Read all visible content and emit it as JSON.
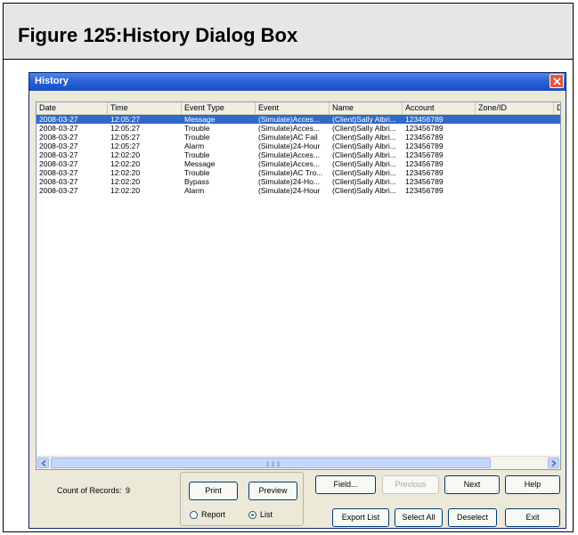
{
  "figure": {
    "title": "Figure 125:History Dialog Box"
  },
  "dialog": {
    "title": "History"
  },
  "columns": [
    "Date",
    "Time",
    "Event Type",
    "Event",
    "Name",
    "Account",
    "Zone/ID",
    "D"
  ],
  "rows": [
    [
      "2008-03-27",
      "12:05:27",
      "Message",
      "(Simulate)Acces...",
      "(Client)Sally Albri...",
      "123456789"
    ],
    [
      "2008-03-27",
      "12:05:27",
      "Trouble",
      "(Simulate)Acces...",
      "(Client)Sally Albri...",
      "123456789"
    ],
    [
      "2008-03-27",
      "12:05:27",
      "Trouble",
      "(Simulate)AC Fail",
      "(Client)Sally Albri...",
      "123456789"
    ],
    [
      "2008-03-27",
      "12:05:27",
      "Alarm",
      "(Simulate)24-Hour",
      "(Client)Sally Albri...",
      "123456789"
    ],
    [
      "2008-03-27",
      "12:02:20",
      "Trouble",
      "(Simulate)Acces...",
      "(Client)Sally Albri...",
      "123456789"
    ],
    [
      "2008-03-27",
      "12:02:20",
      "Message",
      "(Simulate)Acces...",
      "(Client)Sally Albri...",
      "123456789"
    ],
    [
      "2008-03-27",
      "12:02:20",
      "Trouble",
      "(Simulate)AC Tro...",
      "(Client)Sally Albri...",
      "123456789"
    ],
    [
      "2008-03-27",
      "12:02:20",
      "Bypass",
      "(Simulate)24-Ho...",
      "(Client)Sally Albri...",
      "123456789"
    ],
    [
      "2008-03-27",
      "12:02:20",
      "Alarm",
      "(Simulate)24-Hour",
      "(Client)Sally Albri...",
      "123456789"
    ]
  ],
  "selected_row": 0,
  "footer": {
    "count_label": "Count of Records:",
    "count_value": "9",
    "print": "Print",
    "preview": "Preview",
    "report": "Report",
    "list": "List",
    "output_selected": "List",
    "field": "Field...",
    "previous": "Previous",
    "next": "Next",
    "help": "Help",
    "export_list": "Export List",
    "select_all": "Select All",
    "deselect": "Deselect",
    "exit": "Exit"
  },
  "colors": {
    "selection": "#316ac5",
    "titlebar": "#2a62d8",
    "dialog_bg": "#ece9d8"
  }
}
